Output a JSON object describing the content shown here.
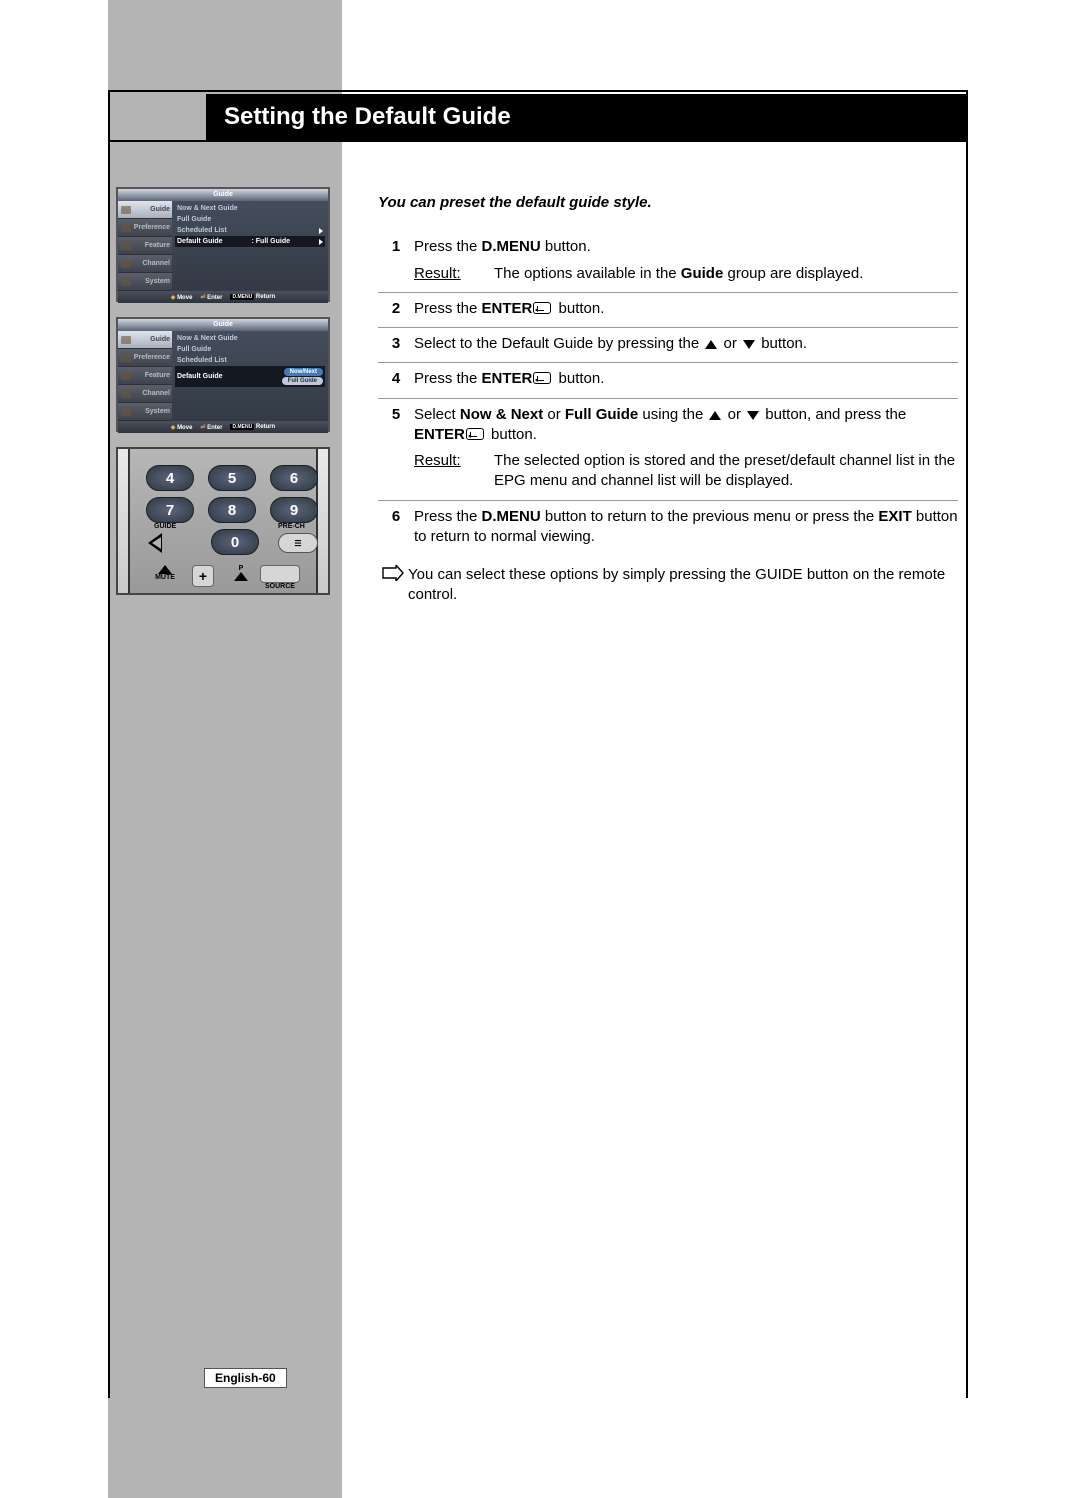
{
  "title": "Setting the Default Guide",
  "intro": "You can preset the default guide style.",
  "menu": {
    "header": "Guide",
    "side_items": [
      "Guide",
      "Preference",
      "Feature",
      "Channel",
      "System"
    ],
    "list1": {
      "row1": "Now & Next Guide",
      "row2": "Full Guide",
      "row3": "Scheduled List",
      "row4_label": "Default Guide",
      "row4_value": ": Full Guide"
    },
    "list2": {
      "row1": "Now & Next Guide",
      "row2": "Full Guide",
      "row3": "Scheduled List",
      "row4_label": "Default Guide",
      "opt1": "Now/Next",
      "opt2": "Full Guide"
    },
    "footer": {
      "move": "Move",
      "enter": "Enter",
      "dmenu": "D.MENU",
      "ret": "Return"
    }
  },
  "remote": {
    "nums": [
      "4",
      "5",
      "6",
      "7",
      "8",
      "9",
      "0"
    ],
    "guide": "GUIDE",
    "prech": "PRE-CH",
    "mute": "MUTE",
    "p": "P",
    "source": "SOURCE"
  },
  "steps": {
    "s1": {
      "n": "1",
      "t_a": "Press the ",
      "t_b": "D.MENU",
      "t_c": " button.",
      "res_lbl": "Result:",
      "res": "The options available in the ",
      "res_b": "Guide",
      "res_c": " group are displayed."
    },
    "s2": {
      "n": "2",
      "t_a": "Press the ",
      "t_b": "ENTER",
      "t_c": " button."
    },
    "s3": {
      "n": "3",
      "t": "Select to the Default Guide by pressing the ",
      "t2": " or ",
      "t3": " button."
    },
    "s4": {
      "n": "4",
      "t_a": "Press the ",
      "t_b": "ENTER",
      "t_c": " button."
    },
    "s5": {
      "n": "5",
      "t_a": "Select ",
      "b1": "Now & Next",
      "t_or": "  or  ",
      "b2": "Full Guide",
      "t_b": " using the ",
      "t_or2": " or ",
      "t_c": " button, and press the ",
      "b3": "ENTER",
      "t_d": " button.",
      "res_lbl": "Result:",
      "res": "The selected option is stored and the preset/default channel list in the EPG menu and channel list will be displayed."
    },
    "s6": {
      "n": "6",
      "t_a": "Press the ",
      "b1": "D.MENU",
      "t_b": " button to return to the previous menu or press the ",
      "b2": "EXIT",
      "t_c": " button to return to normal viewing."
    }
  },
  "note": "You can select these options by simply pressing the GUIDE button on the remote control.",
  "page_num": "English-60"
}
